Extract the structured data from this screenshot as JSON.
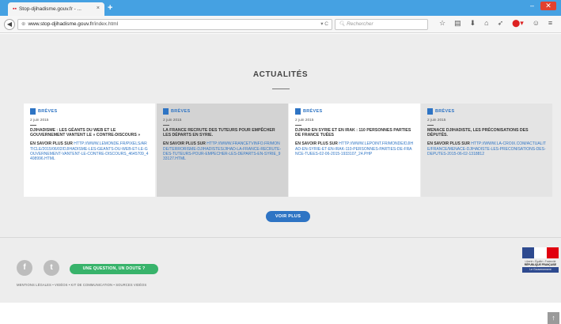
{
  "browser": {
    "tab_title": "Stop-djihadisme.gouv.fr - ...",
    "tab_close": "×",
    "new_tab": "+",
    "url_domain": "www.stop-djihadisme.gouv.fr",
    "url_path": "/index.html",
    "reload": "▾ C",
    "search_placeholder": "Rechercher",
    "window_min": "–",
    "window_close": "✕"
  },
  "section": {
    "title": "ACTUALITÉS"
  },
  "cards": [
    {
      "category": "BRÈVES",
      "date": "2 juin 2015",
      "headline": "Djihadisme : les géants du web et le gouvernement vantent le « contre-discours »",
      "more_label": "EN SAVOIR PLUS SUR ",
      "link": "HTTP://WWW.LEMONDE.FR/PIXELS/ARTICLE/2015/06/02/DJIHADISME-LES-GEANTS-DU-WEB-ET-LE-GOUVERNEMENT-VANTENT-LE-CONTRE-DISCOURS_4645709_4408996.HTML"
    },
    {
      "category": "BRÈVES",
      "date": "2 juin 2015",
      "headline": "La France recrute des tuteurs pour empêcher les départs en Syrie.",
      "more_label": "EN SAVOIR PLUS SUR ",
      "link": "HTTP://WWW.FRANCETVINFO.FR/MONDE/TERRORISME-DJIHADISTES/JIHAD-LA-FRANCE-RECRUTE-DES-TUTEURS-POUR-EMPECHER-LES-DEPARTS-EN-SYRIE_933127.HTML"
    },
    {
      "category": "BRÈVES",
      "date": "2 juin 2015",
      "headline": "Djihad en Syrie et en Irak : 110 personnes parties de France tuées",
      "more_label": "EN SAVOIR PLUS SUR ",
      "link": "HTTP://WWW.LEPOINT.FR/MONDE/DJIHAD-EN-SYRIE-ET-EN-IRAK-110-PERSONNES-PARTIES-DE-FRANCE-TUEES-02-06-2015-1933107_24.PHP"
    },
    {
      "category": "BRÈVES",
      "date": "2 juin 2015",
      "headline": "Menace djihadiste, les préconisations des députés.",
      "more_label": "EN SAVOIR PLUS SUR ",
      "link": "HTTP://WWW.LA-CROIX.COM/ACTUALITE/FRANCE/MENACE-DJIHADISTE-LES-PRECONISATIONS-DES-DEPUTES-2015-06-02-1318812"
    }
  ],
  "voir_plus": "VOIR PLUS",
  "footer": {
    "facebook": "f",
    "twitter": "t",
    "question_button": "UNE QUESTION, UN DOUTE ?",
    "links": "MENTIONS LÉGALES  •  VIDÉOS  •  KIT DE COMMUNICATION  •  SOURCES VIDÉOS",
    "rf_motto": "Liberté • Égalité • Fraternité",
    "rf_name": "RÉPUBLIQUE FRANÇAISE",
    "rf_gov": "Le Gouvernement"
  },
  "colors": {
    "accent": "#2e74c4",
    "question_green": "#38b36b",
    "tab_bar": "#45a1e2"
  }
}
